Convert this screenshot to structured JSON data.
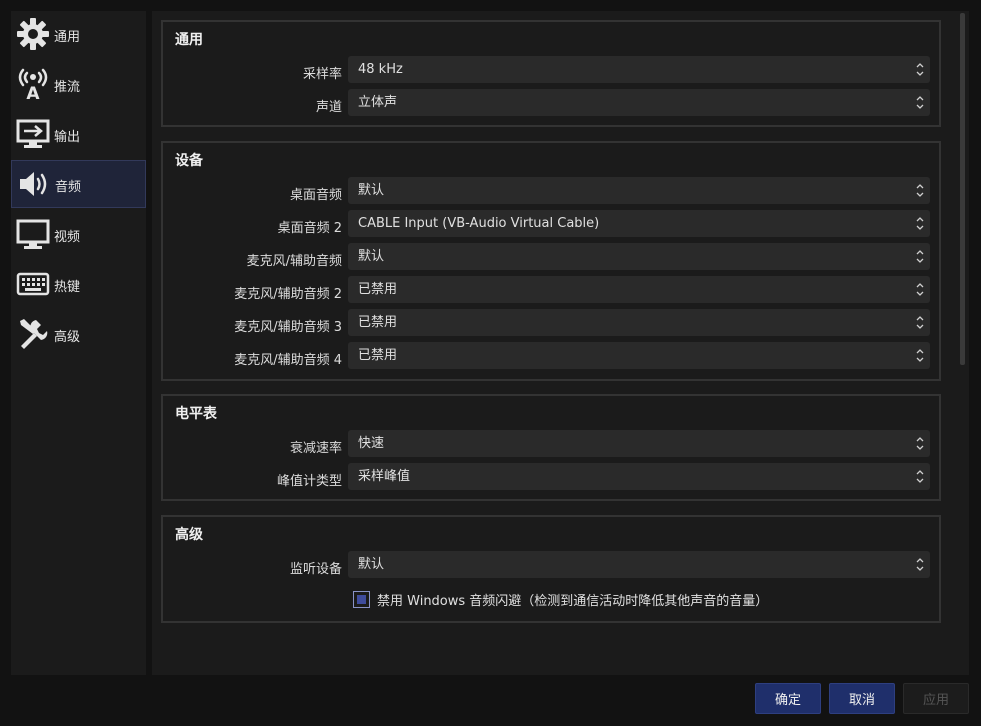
{
  "sidebar": {
    "items": [
      {
        "label": "通用",
        "icon": "gear-icon"
      },
      {
        "label": "推流",
        "icon": "broadcast-antenna-icon"
      },
      {
        "label": "输出",
        "icon": "output-monitor-icon"
      },
      {
        "label": "音频",
        "icon": "speaker-icon"
      },
      {
        "label": "视频",
        "icon": "monitor-icon"
      },
      {
        "label": "热键",
        "icon": "keyboard-icon"
      },
      {
        "label": "高级",
        "icon": "tools-icon"
      }
    ],
    "active_index": 3
  },
  "groups": {
    "general": {
      "title": "通用",
      "rows": [
        {
          "label": "采样率",
          "value": "48 kHz"
        },
        {
          "label": "声道",
          "value": "立体声"
        }
      ]
    },
    "devices": {
      "title": "设备",
      "rows": [
        {
          "label": "桌面音频",
          "value": "默认"
        },
        {
          "label": "桌面音频 2",
          "value": "CABLE Input (VB-Audio Virtual Cable)"
        },
        {
          "label": "麦克风/辅助音频",
          "value": "默认"
        },
        {
          "label": "麦克风/辅助音频 2",
          "value": "已禁用"
        },
        {
          "label": "麦克风/辅助音频 3",
          "value": "已禁用"
        },
        {
          "label": "麦克风/辅助音频 4",
          "value": "已禁用"
        }
      ]
    },
    "meters": {
      "title": "电平表",
      "rows": [
        {
          "label": "衰减速率",
          "value": "快速"
        },
        {
          "label": "峰值计类型",
          "value": "采样峰值"
        }
      ]
    },
    "advanced": {
      "title": "高级",
      "rows": [
        {
          "label": "监听设备",
          "value": "默认"
        }
      ],
      "checkbox_label": "禁用 Windows 音频闪避（检测到通信活动时降低其他声音的音量）",
      "checkbox_checked": true
    }
  },
  "buttons": {
    "ok": "确定",
    "cancel": "取消",
    "apply": "应用"
  },
  "colors": {
    "accent": "#1f2f6b",
    "active_item": "#1f2439",
    "background": "#1b1b1b"
  }
}
